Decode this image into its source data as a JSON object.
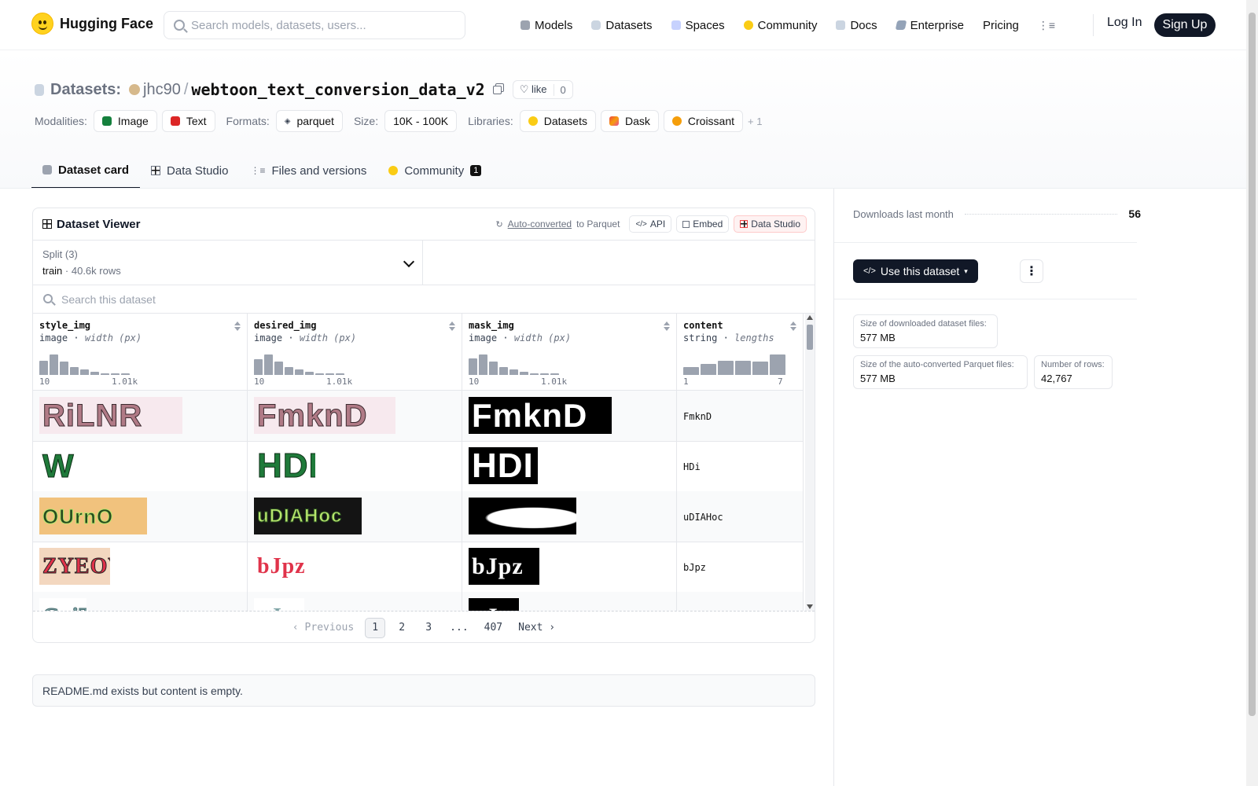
{
  "brand": {
    "name": "Hugging Face"
  },
  "topnav": {
    "search_placeholder": "Search models, datasets, users...",
    "links": [
      {
        "label": "Models",
        "color": "#9ca3af"
      },
      {
        "label": "Datasets",
        "color": "#cbd5e1"
      },
      {
        "label": "Spaces",
        "color": "#c7d2fe"
      },
      {
        "label": "Community",
        "color": "#facc15"
      },
      {
        "label": "Docs",
        "color": "#cbd5e1"
      },
      {
        "label": "Enterprise",
        "color": "#94a3b8"
      },
      {
        "label": "Pricing",
        "color": ""
      }
    ],
    "login": "Log In",
    "signup": "Sign Up"
  },
  "repo": {
    "type_label": "Datasets:",
    "user": "jhc90",
    "separator": "/",
    "name": "webtoon_text_conversion_data_v2",
    "like_label": "like",
    "like_count": "0"
  },
  "tags": {
    "modalities_label": "Modalities:",
    "modalities": [
      "Image",
      "Text"
    ],
    "formats_label": "Formats:",
    "formats": [
      "parquet"
    ],
    "size_label": "Size:",
    "size": "10K - 100K",
    "libraries_label": "Libraries:",
    "libraries": [
      "Datasets",
      "Dask",
      "Croissant"
    ],
    "more": "+ 1"
  },
  "tabs": [
    {
      "label": "Dataset card",
      "active": true
    },
    {
      "label": "Data Studio",
      "active": false
    },
    {
      "label": "Files and versions",
      "active": false
    },
    {
      "label": "Community",
      "active": false,
      "badge": "1"
    }
  ],
  "viewer": {
    "title": "Dataset Viewer",
    "auto_converted": "Auto-converted",
    "to_parquet": "to Parquet",
    "api": "API",
    "embed": "Embed",
    "data_studio": "Data Studio",
    "split_label": "Split (3)",
    "split_value": "train",
    "split_rows": "40.6k rows",
    "search_placeholder": "Search this dataset",
    "columns": [
      {
        "name": "style_img",
        "type": "image",
        "stat": "width (px)",
        "min": "10",
        "max": "1.01k",
        "hist": [
          0.7,
          1.0,
          0.65,
          0.4,
          0.25,
          0.15,
          0.08,
          0.05,
          0.04
        ]
      },
      {
        "name": "desired_img",
        "type": "image",
        "stat": "width (px)",
        "min": "10",
        "max": "1.01k",
        "hist": [
          0.75,
          1.0,
          0.65,
          0.4,
          0.25,
          0.15,
          0.08,
          0.05,
          0.04
        ]
      },
      {
        "name": "mask_img",
        "type": "image",
        "stat": "width (px)",
        "min": "10",
        "max": "1.01k",
        "hist": [
          0.8,
          1.0,
          0.65,
          0.4,
          0.25,
          0.15,
          0.08,
          0.05,
          0.04
        ]
      },
      {
        "name": "content",
        "type": "string",
        "stat": "lengths",
        "min": "1",
        "max": "7",
        "hist": [
          0.4,
          0.55,
          0.7,
          0.7,
          0.65,
          1.0
        ]
      }
    ],
    "rows": [
      {
        "style": "RiLNR",
        "desired": "FmknD",
        "mask": "FmknD",
        "content": "FmknD"
      },
      {
        "style": "W",
        "desired": "HDI",
        "mask": "HDI",
        "content": "HDi"
      },
      {
        "style": "OUrnO",
        "desired": "uDIAHoc",
        "mask": "",
        "content": "uDIAHoc"
      },
      {
        "style": "ZYEOVd",
        "desired": "bJpz",
        "mask": "bJpz",
        "content": "bJpz"
      },
      {
        "style": "GoiT",
        "desired": "nJ",
        "mask": "nJ",
        "content": ""
      }
    ],
    "pager": {
      "prev": "Previous",
      "pages": [
        "1",
        "2",
        "3",
        "...",
        "407"
      ],
      "next": "Next"
    }
  },
  "readme_text": "README.md exists but content is empty.",
  "sidebar": {
    "downloads_label": "Downloads last month",
    "downloads_value": "56",
    "use_button": "Use this dataset",
    "stats": [
      {
        "k": "Size of downloaded dataset files:",
        "v": "577 MB"
      },
      {
        "k": "Size of the auto-converted Parquet files:",
        "v": "577 MB"
      },
      {
        "k": "Number of rows:",
        "v": "42,767"
      }
    ]
  }
}
